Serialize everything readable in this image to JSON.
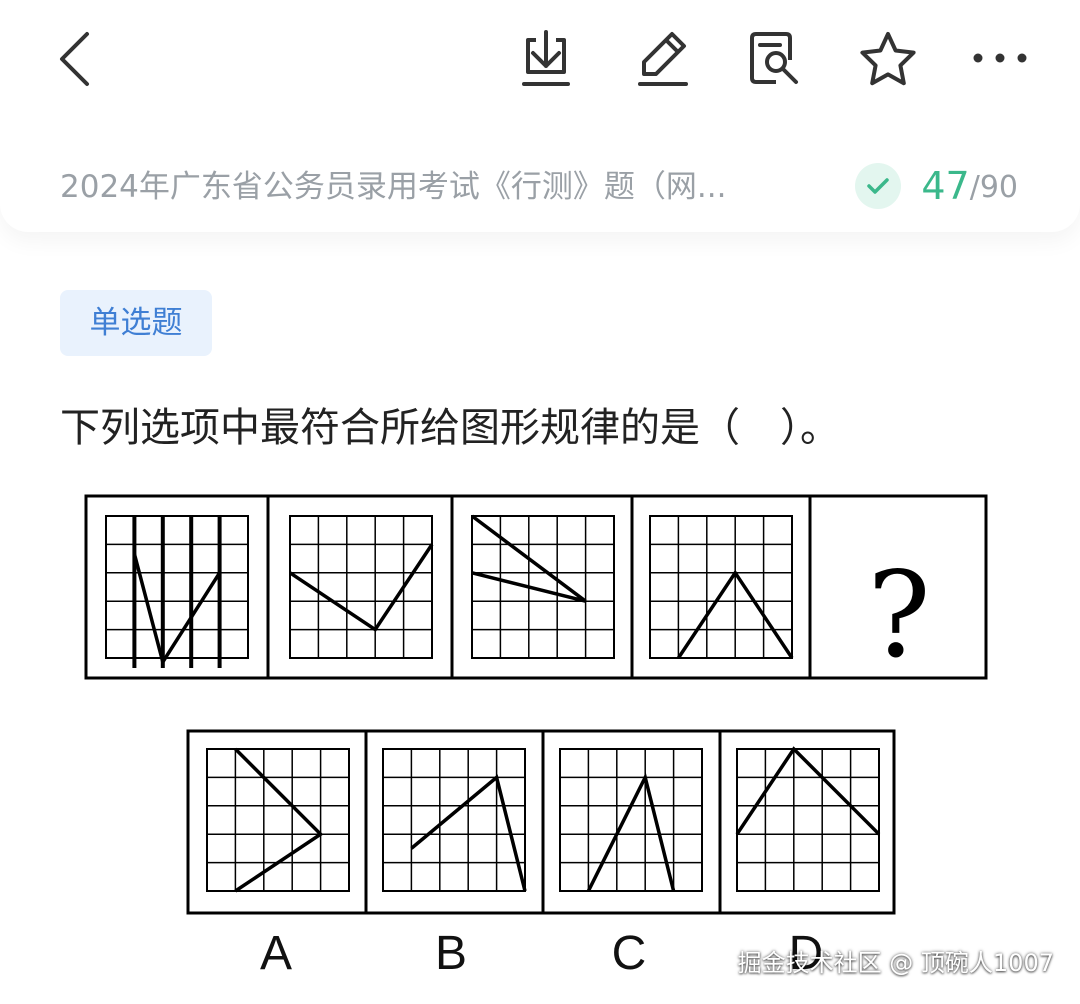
{
  "toolbar": {
    "back_icon": "chevron-left-icon",
    "download_icon": "download-icon",
    "edit_icon": "pencil-icon",
    "notes_icon": "note-search-icon",
    "favorite_icon": "star-icon",
    "more_icon": "more-horizontal-icon"
  },
  "exam": {
    "title": "2024年广东省公务员录用考试《行测》题（网...",
    "progress_current": "47",
    "progress_total": "/90",
    "accent_color": "#3bb88b"
  },
  "question": {
    "type_badge": "单选题",
    "text": "下列选项中最符合所给图形规律的是（　）。",
    "options": [
      "A",
      "B",
      "C",
      "D"
    ],
    "question_mark": "?"
  },
  "watermark": "掘金技术社区 @ 顶碗人1007"
}
